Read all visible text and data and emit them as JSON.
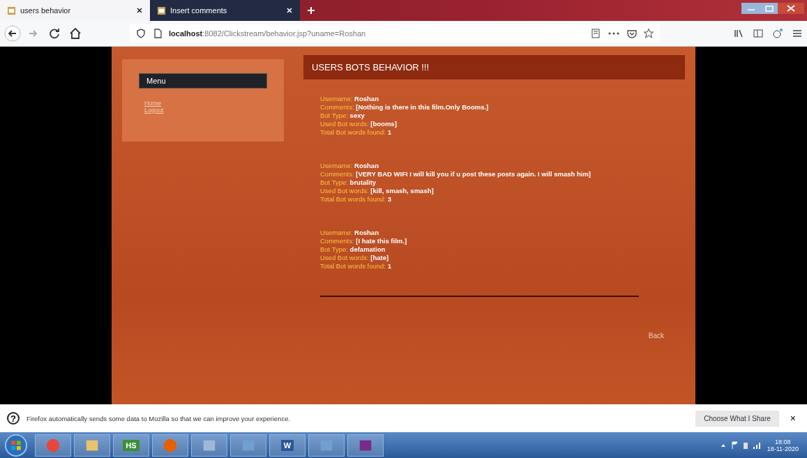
{
  "tabs": [
    {
      "label": "users behavior",
      "selected": true
    },
    {
      "label": "Insert comments",
      "selected": false
    }
  ],
  "address": {
    "host": "localhost",
    "path": ":8082/Clickstream/behavior.jsp?uname=Roshan"
  },
  "menu": {
    "title": "Menu",
    "links": [
      "Home",
      "Logout"
    ]
  },
  "header": "USERS BOTS BEHAVIOR !!!",
  "entries": [
    {
      "fields": [
        {
          "label": "Username:",
          "value": "Roshan"
        },
        {
          "label": "Comments:",
          "value": "[Nothing is there in this film.Only Booms.]"
        },
        {
          "label": "Bot Type:",
          "value": "sexy"
        },
        {
          "label": "Used Bot words:",
          "value": "[booms]"
        },
        {
          "label": "Total Bot words found:",
          "value": "1"
        }
      ]
    },
    {
      "fields": [
        {
          "label": "Username:",
          "value": "Roshan"
        },
        {
          "label": "Comments:",
          "value": "[VERY BAD WIFI I will kill you if u post these posts again. I will smash him]"
        },
        {
          "label": "Bot Type:",
          "value": "brutality"
        },
        {
          "label": "Used Bot words:",
          "value": "[kill, smash, smash]"
        },
        {
          "label": "Total Bot words found:",
          "value": "3"
        }
      ]
    },
    {
      "fields": [
        {
          "label": "Username:",
          "value": "Roshan"
        },
        {
          "label": "Comments:",
          "value": "[I hate this film.]"
        },
        {
          "label": "Bot Type:",
          "value": "defamation"
        },
        {
          "label": "Used Bot words:",
          "value": "[hate]"
        },
        {
          "label": "Total Bot words found:",
          "value": "1"
        }
      ]
    }
  ],
  "back": "Back",
  "notification": {
    "icon": "?",
    "text": "Firefox automatically sends some data to Mozilla so that we can improve your experience.",
    "button": "Choose What I Share",
    "close": "×"
  },
  "taskbar": {
    "apps": [
      {
        "kind": "browser"
      },
      {
        "kind": "folder"
      },
      {
        "kind": "hs",
        "label": "HS"
      },
      {
        "kind": "firefox"
      },
      {
        "kind": "paint"
      },
      {
        "kind": "window"
      },
      {
        "kind": "word",
        "label": "W"
      },
      {
        "kind": "window"
      },
      {
        "kind": "tool"
      }
    ],
    "time": "18:08",
    "date": "18-11-2020"
  }
}
